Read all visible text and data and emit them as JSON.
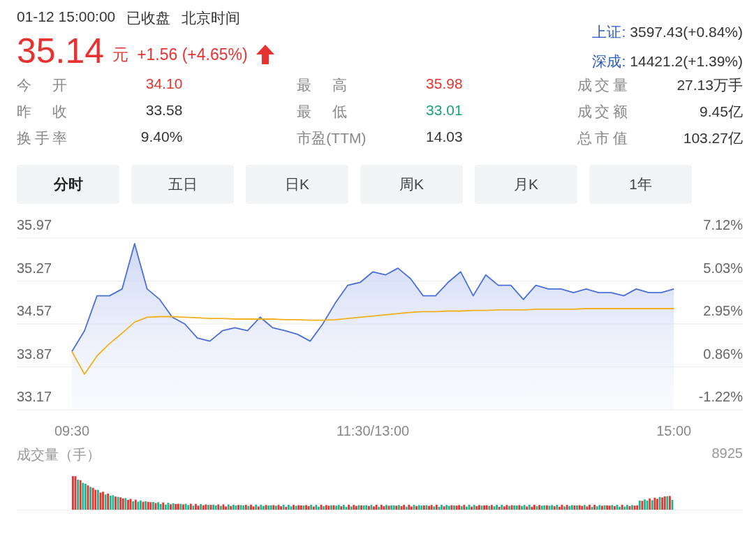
{
  "header": {
    "datetime": "01-12 15:00:00",
    "status": "已收盘",
    "timezone": "北京时间"
  },
  "quote": {
    "price": "35.14",
    "unit": "元",
    "change": "+1.56 (+4.65%)",
    "rising": true
  },
  "indices": [
    {
      "name": "上证:",
      "value": "3597.43(+0.84%)"
    },
    {
      "name": "深成:",
      "value": "14421.2(+1.39%)"
    }
  ],
  "stats": [
    [
      {
        "label": "今开",
        "value": "34.10",
        "color": "#e8322f"
      },
      {
        "label": "昨收",
        "value": "33.58",
        "color": "#333333"
      },
      {
        "label": "换手率",
        "value": "9.40%",
        "color": "#333333"
      }
    ],
    [
      {
        "label": "最高",
        "value": "35.98",
        "color": "#e8322f"
      },
      {
        "label": "最低",
        "value": "33.01",
        "color": "#1aa27a"
      },
      {
        "label": "市盈(TTM)",
        "value": "14.03",
        "color": "#333333"
      }
    ],
    [
      {
        "label": "成交量",
        "value": "27.13万手",
        "color": "#333333"
      },
      {
        "label": "成交额",
        "value": "9.45亿",
        "color": "#333333"
      },
      {
        "label": "总市值",
        "value": "103.27亿",
        "color": "#333333"
      }
    ]
  ],
  "tabs": [
    {
      "label": "分时",
      "selected": true
    },
    {
      "label": "五日",
      "selected": false
    },
    {
      "label": "日K",
      "selected": false
    },
    {
      "label": "周K",
      "selected": false
    },
    {
      "label": "月K",
      "selected": false
    },
    {
      "label": "1年",
      "selected": false
    }
  ],
  "chart_data": {
    "type": "line",
    "categories": [
      "09:30",
      null,
      null,
      null,
      null,
      null,
      null,
      null,
      null,
      null,
      null,
      null,
      null,
      null,
      null,
      null,
      null,
      null,
      null,
      null,
      null,
      null,
      null,
      null,
      "11:30/13:00",
      null,
      null,
      null,
      null,
      null,
      null,
      null,
      null,
      null,
      null,
      null,
      null,
      null,
      null,
      null,
      null,
      null,
      null,
      null,
      null,
      null,
      null,
      null,
      "15:00"
    ],
    "grid": true,
    "series": [
      {
        "type": "area",
        "color": "#4a6fd8",
        "values": [
          34.12,
          34.46,
          35.03,
          35.03,
          35.14,
          35.88,
          35.14,
          34.97,
          34.68,
          34.57,
          34.34,
          34.29,
          34.46,
          34.51,
          34.46,
          34.68,
          34.51,
          34.46,
          34.4,
          34.29,
          34.57,
          34.91,
          35.2,
          35.25,
          35.42,
          35.37,
          35.48,
          35.31,
          35.03,
          35.03,
          35.25,
          35.42,
          35.03,
          35.37,
          35.2,
          35.2,
          34.97,
          35.2,
          35.14,
          35.14,
          35.08,
          35.14,
          35.08,
          35.08,
          35.03,
          35.14,
          35.08,
          35.08,
          35.14
        ]
      },
      {
        "type": "line",
        "color": "#f2b01e",
        "values": [
          34.12,
          33.75,
          34.05,
          34.25,
          34.42,
          34.6,
          34.68,
          34.69,
          34.69,
          34.68,
          34.67,
          34.66,
          34.66,
          34.65,
          34.65,
          34.65,
          34.65,
          34.64,
          34.64,
          34.63,
          34.63,
          34.64,
          34.66,
          34.68,
          34.7,
          34.72,
          34.74,
          34.76,
          34.77,
          34.77,
          34.78,
          34.78,
          34.79,
          34.79,
          34.8,
          34.8,
          34.8,
          34.81,
          34.81,
          34.81,
          34.81,
          34.82,
          34.82,
          34.82,
          34.82,
          34.82,
          34.82,
          34.82,
          34.82
        ]
      }
    ],
    "ylim": [
      33.17,
      35.97
    ],
    "yticks": [
      33.17,
      33.87,
      34.57,
      35.27,
      35.97
    ]
  },
  "percent_axis": [
    "7.12%",
    "5.03%",
    "2.95%",
    "0.86%",
    "-1.22%"
  ],
  "volume": {
    "title": "成交量（手）",
    "max_label": "8925"
  }
}
